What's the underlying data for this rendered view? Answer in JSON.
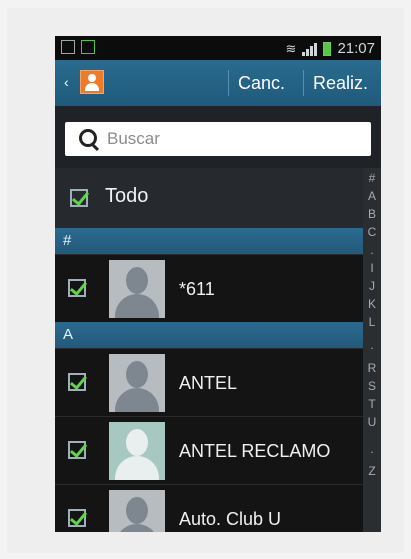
{
  "status_bar": {
    "time": "21:07"
  },
  "action_bar": {
    "back_glyph": "‹",
    "cancel_label": "Canc.",
    "done_label": "Realiz."
  },
  "search": {
    "placeholder": "Buscar",
    "value": ""
  },
  "select_all": {
    "label": "Todo",
    "checked": true
  },
  "sections": [
    {
      "header": "#",
      "contacts": [
        {
          "name": "*611",
          "checked": true
        }
      ]
    },
    {
      "header": "A",
      "contacts": [
        {
          "name": "ANTEL",
          "checked": true
        },
        {
          "name": "ANTEL RECLAMO",
          "checked": true
        },
        {
          "name": "Auto. Club U",
          "checked": true
        }
      ]
    }
  ],
  "index_letters": [
    "#",
    "A",
    "B",
    "C",
    ".",
    "I",
    "J",
    "K",
    "L",
    ".",
    "R",
    "S",
    "T",
    "U",
    ".",
    "Z"
  ],
  "colors": {
    "accent_blue": "#2a6b8e",
    "check_green": "#5fd44a",
    "app_icon_orange": "#ef7a2a"
  },
  "icons": [
    "back-chevron-icon",
    "contacts-app-icon",
    "search-icon",
    "checkbox-checked-icon",
    "default-avatar-icon"
  ]
}
